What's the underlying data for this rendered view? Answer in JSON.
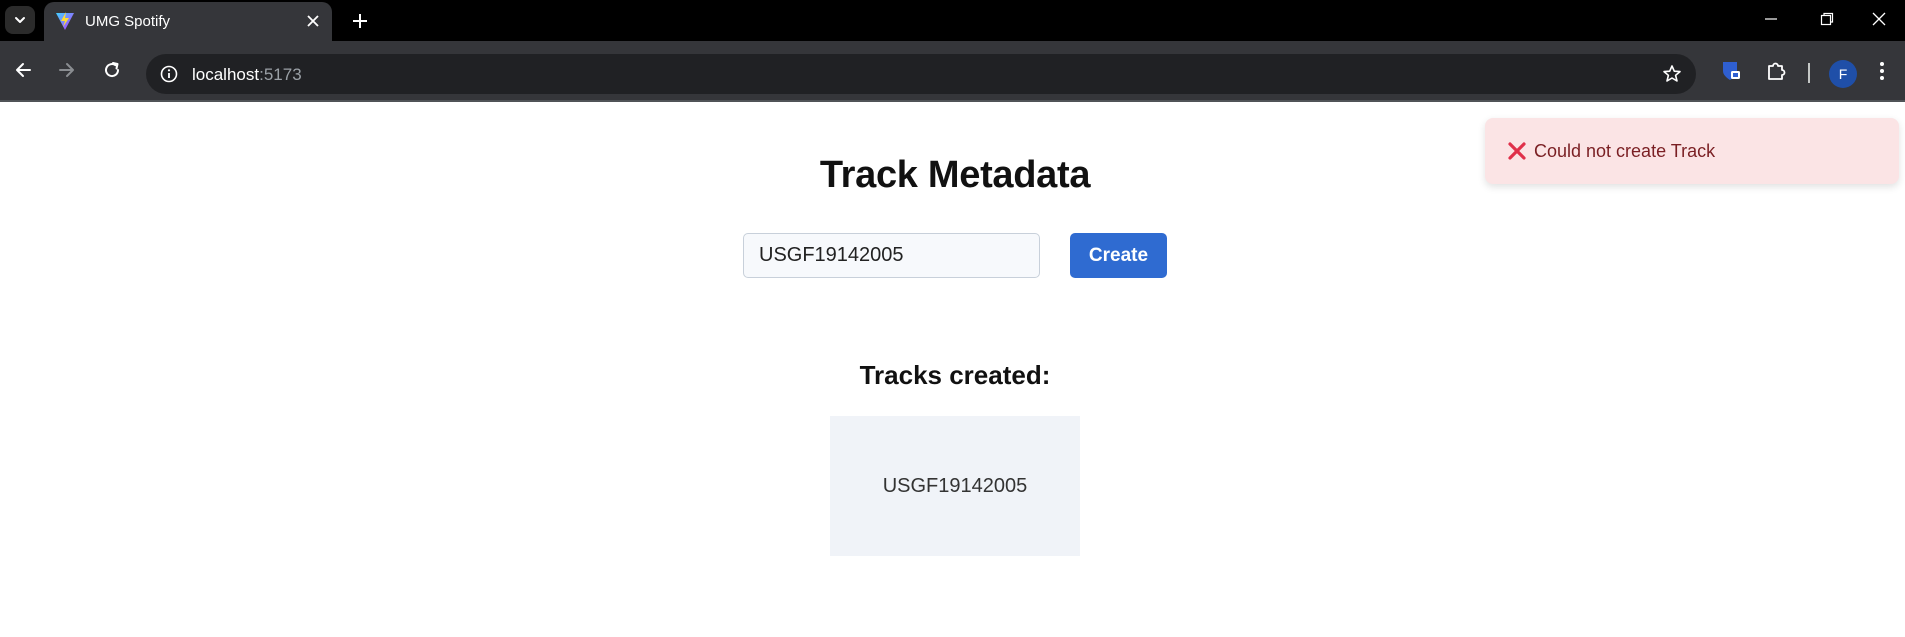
{
  "browser": {
    "tab": {
      "title": "UMG Spotify"
    },
    "omnibox": {
      "host": "localhost",
      "port": ":5173"
    },
    "profile": {
      "initial": "F"
    }
  },
  "page": {
    "title": "Track Metadata",
    "form": {
      "isrc_value": "USGF19142005",
      "create_label": "Create"
    },
    "tracks_heading": "Tracks created:",
    "tracks": [
      {
        "isrc": "USGF19142005"
      }
    ]
  },
  "toast": {
    "type": "error",
    "message": "Could not create Track",
    "color": "#e0304a"
  },
  "colors": {
    "primary_button": "#2f6bd1",
    "toast_background": "#fbe4e5",
    "card_background": "#f0f3f8"
  }
}
